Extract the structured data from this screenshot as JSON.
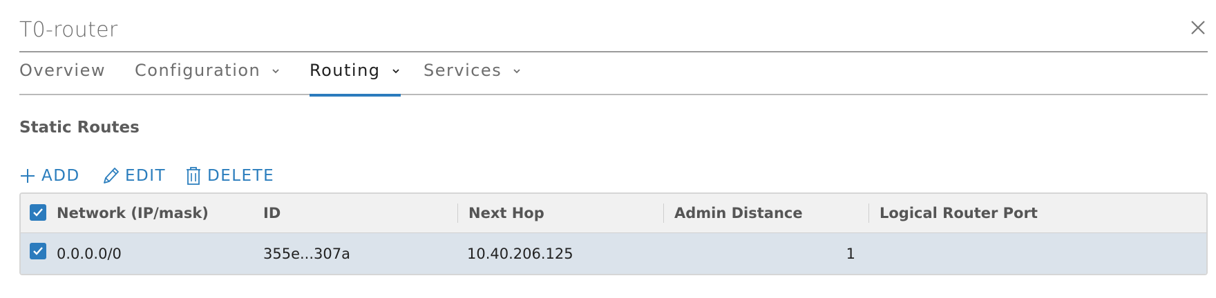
{
  "window": {
    "title": "T0-router",
    "close_icon": "close-icon"
  },
  "tabs": [
    {
      "label": "Overview",
      "has_dropdown": false,
      "active": false
    },
    {
      "label": "Configuration",
      "has_dropdown": true,
      "active": false
    },
    {
      "label": "Routing",
      "has_dropdown": true,
      "active": true
    },
    {
      "label": "Services",
      "has_dropdown": true,
      "active": false
    }
  ],
  "section": {
    "title": "Static Routes"
  },
  "actions": {
    "add_label": "ADD",
    "edit_label": "EDIT",
    "delete_label": "DELETE"
  },
  "table": {
    "columns": [
      "Network (IP/mask)",
      "ID",
      "Next Hop",
      "Admin Distance",
      "Logical Router Port"
    ],
    "header_checkbox_checked": true,
    "rows": [
      {
        "checked": true,
        "network": "0.0.0.0/0",
        "id": "355e...307a",
        "next_hop": "10.40.206.125",
        "admin_distance": "1",
        "logical_router_port": ""
      }
    ]
  },
  "colors": {
    "accent": "#2b7bbd",
    "selected_row": "#dbe3eb",
    "header_bg": "#f1f1f1"
  }
}
